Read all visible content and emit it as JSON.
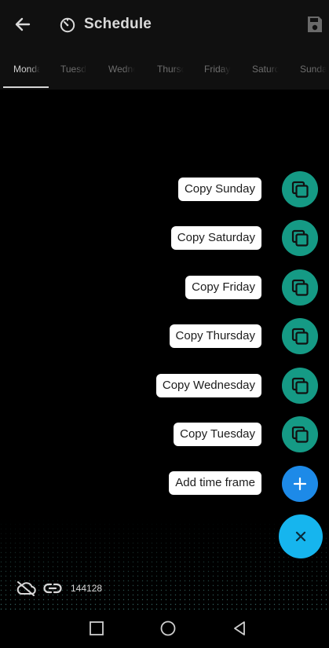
{
  "app": {
    "title": "Schedule"
  },
  "tabs": [
    {
      "label": "Monday",
      "active": true
    },
    {
      "label": "Tuesday",
      "active": false
    },
    {
      "label": "Wednesday",
      "active": false
    },
    {
      "label": "Thursday",
      "active": false
    },
    {
      "label": "Friday",
      "active": false
    },
    {
      "label": "Saturday",
      "active": false
    },
    {
      "label": "Sunday",
      "active": false
    }
  ],
  "speed_dial": {
    "actions": [
      {
        "label": "Copy Sunday",
        "icon": "copy-icon"
      },
      {
        "label": "Copy Saturday",
        "icon": "copy-icon"
      },
      {
        "label": "Copy Friday",
        "icon": "copy-icon"
      },
      {
        "label": "Copy Thursday",
        "icon": "copy-icon"
      },
      {
        "label": "Copy Wednesday",
        "icon": "copy-icon"
      },
      {
        "label": "Copy Tuesday",
        "icon": "copy-icon"
      },
      {
        "label": "Add time frame",
        "icon": "plus-icon"
      }
    ],
    "main_icon": "close-icon"
  },
  "status": {
    "cloud_icon": "cloud-off-icon",
    "link_icon": "link-icon",
    "count": "144128"
  },
  "colors": {
    "copy_fab": "#159a85",
    "add_fab": "#1d8ae8",
    "main_fab": "#16b5ee",
    "background": "#000000"
  }
}
